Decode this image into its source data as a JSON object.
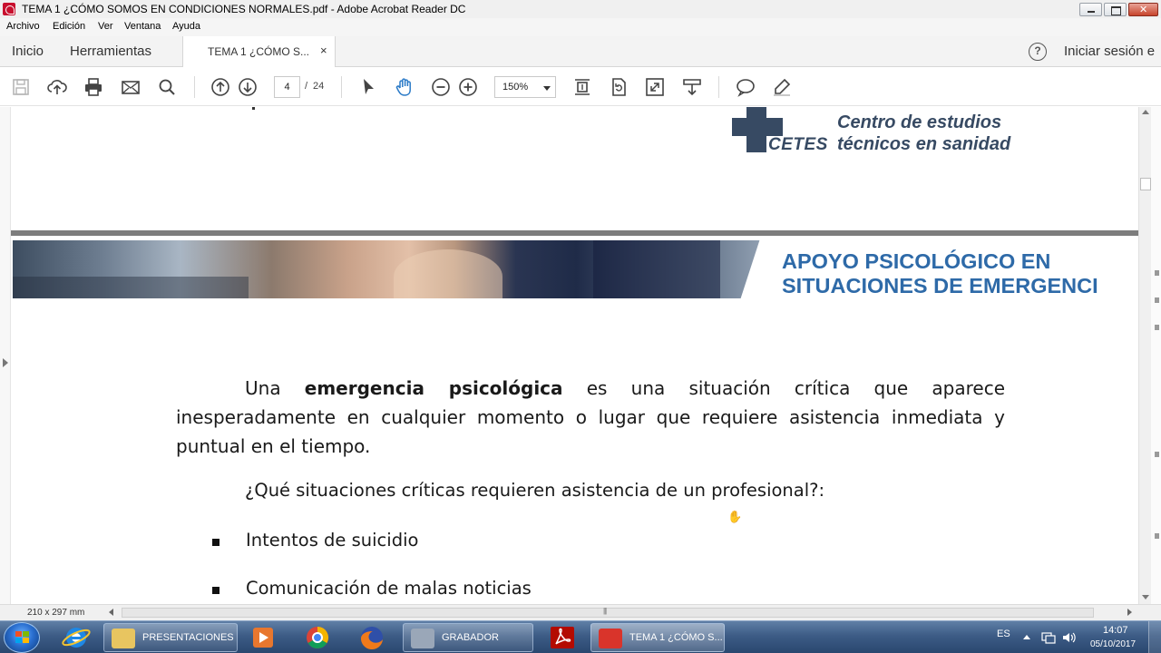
{
  "window": {
    "title": "TEMA 1 ¿CÓMO SOMOS EN CONDICIONES NORMALES.pdf - Adobe Acrobat Reader DC"
  },
  "menu": [
    "Archivo",
    "Edición",
    "Ver",
    "Ventana",
    "Ayuda"
  ],
  "tabs": {
    "home": "Inicio",
    "tools": "Herramientas",
    "document": "TEMA 1 ¿CÓMO S...",
    "close": "×",
    "help": "?",
    "signin": "Iniciar sesión e"
  },
  "toolbar": {
    "current_page": "4",
    "page_separator": "/",
    "total_pages": "24",
    "zoom": "150%"
  },
  "document": {
    "logo": {
      "abbr": "CETES",
      "line1": "Centro de estudios",
      "line2": "técnicos en sanidad"
    },
    "banner": {
      "line1": "APOYO PSICOLÓGICO EN",
      "line2": "SITUACIONES DE EMERGENCI"
    },
    "paragraph": {
      "start": "Una ",
      "bold": "emergencia psicológica",
      "rest": " es una situación crítica que aparece inesperadamente en cualquier momento o lugar que requiere asistencia inmediata y puntual en el tiempo."
    },
    "question": "¿Qué situaciones críticas requieren asistencia de un profesional?:",
    "bullets": [
      "Intentos de suicidio",
      "Comunicación de malas noticias"
    ]
  },
  "status": {
    "page_size": "210 x 297 mm"
  },
  "taskbar": {
    "items": [
      "PRESENTACIONES",
      "GRABADOR",
      "TEMA 1 ¿CÓMO S..."
    ],
    "language": "ES",
    "time": "14:07",
    "date": "05/10/2017"
  },
  "colors": {
    "logo": "#374a63",
    "banner_title": "#2e6aa8",
    "taskbar": "#3d5c86"
  }
}
